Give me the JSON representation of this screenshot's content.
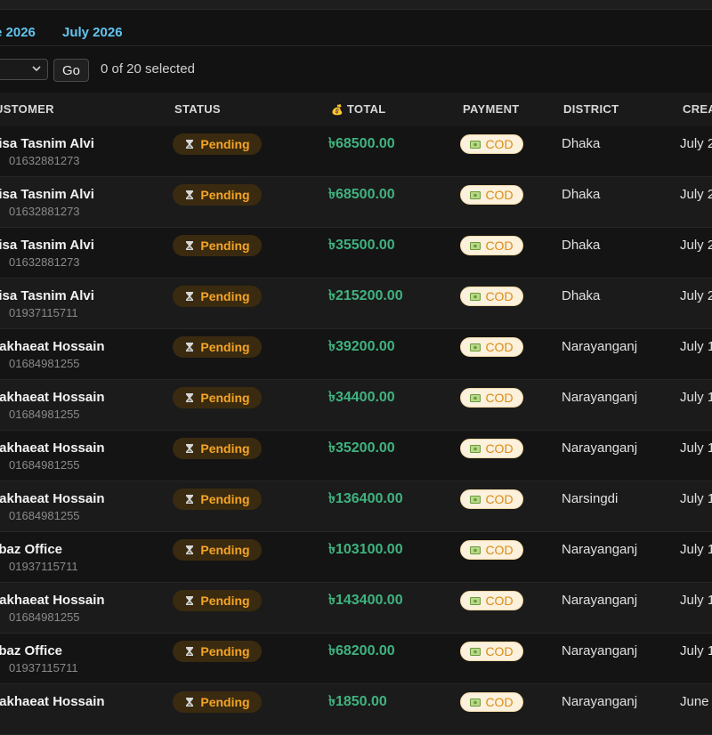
{
  "tabs": [
    "e 2026",
    "July 2026"
  ],
  "actions": {
    "go_label": "Go",
    "selected_text": "0 of 20 selected"
  },
  "columns": {
    "customer": "USTOMER",
    "status": "STATUS",
    "total_icon": "💰",
    "total": "TOTAL",
    "payment": "PAYMENT",
    "district": "DISTRICT",
    "created": "CREA"
  },
  "colors": {
    "accent": "#62c4f0",
    "pending": "#f5a524",
    "total": "#3fb37f",
    "cod_bg": "#fbf1dc"
  },
  "icons": {
    "status": "hourglass-icon",
    "payment": "cash-icon",
    "phone": "phone-icon"
  },
  "rows": [
    {
      "name": "aisa Tasnim Alvi",
      "phone": "01632881273",
      "status": "Pending",
      "total": "৳68500.00",
      "payment": "COD",
      "district": "Dhaka",
      "created": "July 2"
    },
    {
      "name": "aisa Tasnim Alvi",
      "phone": "01632881273",
      "status": "Pending",
      "total": "৳68500.00",
      "payment": "COD",
      "district": "Dhaka",
      "created": "July 2"
    },
    {
      "name": "aisa Tasnim Alvi",
      "phone": "01632881273",
      "status": "Pending",
      "total": "৳35500.00",
      "payment": "COD",
      "district": "Dhaka",
      "created": "July 2"
    },
    {
      "name": "aisa Tasnim Alvi",
      "phone": "01937115711",
      "status": "Pending",
      "total": "৳215200.00",
      "payment": "COD",
      "district": "Dhaka",
      "created": "July 2"
    },
    {
      "name": "hakhaeat Hossain",
      "phone": "01684981255",
      "status": "Pending",
      "total": "৳39200.00",
      "payment": "COD",
      "district": "Narayanganj",
      "created": "July 1"
    },
    {
      "name": "hakhaeat Hossain",
      "phone": "01684981255",
      "status": "Pending",
      "total": "৳34400.00",
      "payment": "COD",
      "district": "Narayanganj",
      "created": "July 1"
    },
    {
      "name": "hakhaeat Hossain",
      "phone": "01684981255",
      "status": "Pending",
      "total": "৳35200.00",
      "payment": "COD",
      "district": "Narayanganj",
      "created": "July 1"
    },
    {
      "name": "hakhaeat Hossain",
      "phone": "01684981255",
      "status": "Pending",
      "total": "৳136400.00",
      "payment": "COD",
      "district": "Narsingdi",
      "created": "July 1"
    },
    {
      "name": "ebaz Office",
      "phone": "01937115711",
      "status": "Pending",
      "total": "৳103100.00",
      "payment": "COD",
      "district": "Narayanganj",
      "created": "July 1"
    },
    {
      "name": "hakhaeat Hossain",
      "phone": "01684981255",
      "status": "Pending",
      "total": "৳143400.00",
      "payment": "COD",
      "district": "Narayanganj",
      "created": "July 1"
    },
    {
      "name": "ebaz Office",
      "phone": "01937115711",
      "status": "Pending",
      "total": "৳68200.00",
      "payment": "COD",
      "district": "Narayanganj",
      "created": "July 1"
    },
    {
      "name": "hakhaeat Hossain",
      "phone": "",
      "status": "Pending",
      "total": "৳1850.00",
      "payment": "COD",
      "district": "Narayanganj",
      "created": "June"
    }
  ]
}
